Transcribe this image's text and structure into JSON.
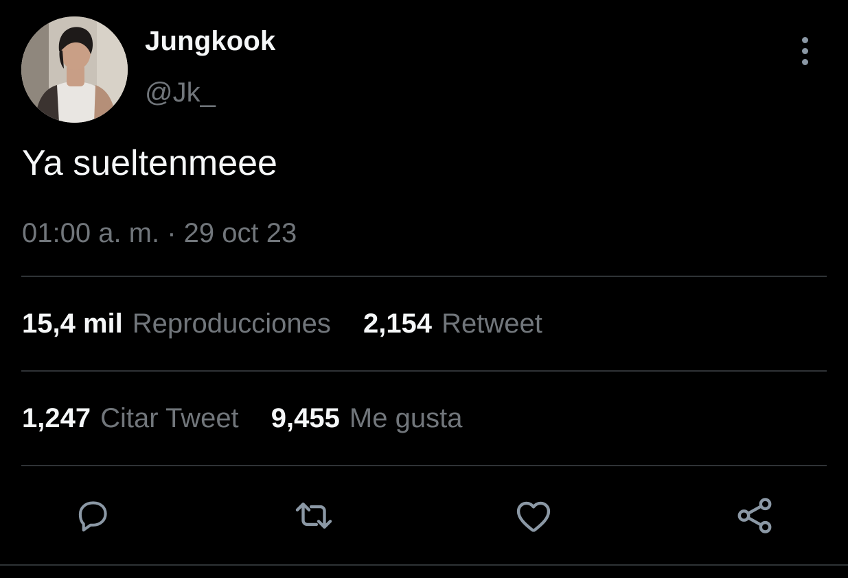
{
  "tweet": {
    "author": {
      "display_name": "Jungkook",
      "handle": "@Jk_"
    },
    "text": "Ya sueltenmeee",
    "timestamp": "01:00 a. m. · 29 oct 23",
    "stats": {
      "views": {
        "value": "15,4 mil",
        "label": "Reproducciones"
      },
      "retweets": {
        "value": "2,154",
        "label": "Retweet"
      },
      "quotes": {
        "value": "1,247",
        "label": "Citar Tweet"
      },
      "likes": {
        "value": "9,455",
        "label": "Me gusta"
      }
    },
    "actions": [
      "reply-icon",
      "retweet-icon",
      "like-icon",
      "share-icon"
    ]
  },
  "colors": {
    "background": "#000000",
    "primary_text": "#f5f7f8",
    "secondary_text": "#71767b",
    "divider": "#2f3336",
    "icon": "#8b98a5"
  }
}
